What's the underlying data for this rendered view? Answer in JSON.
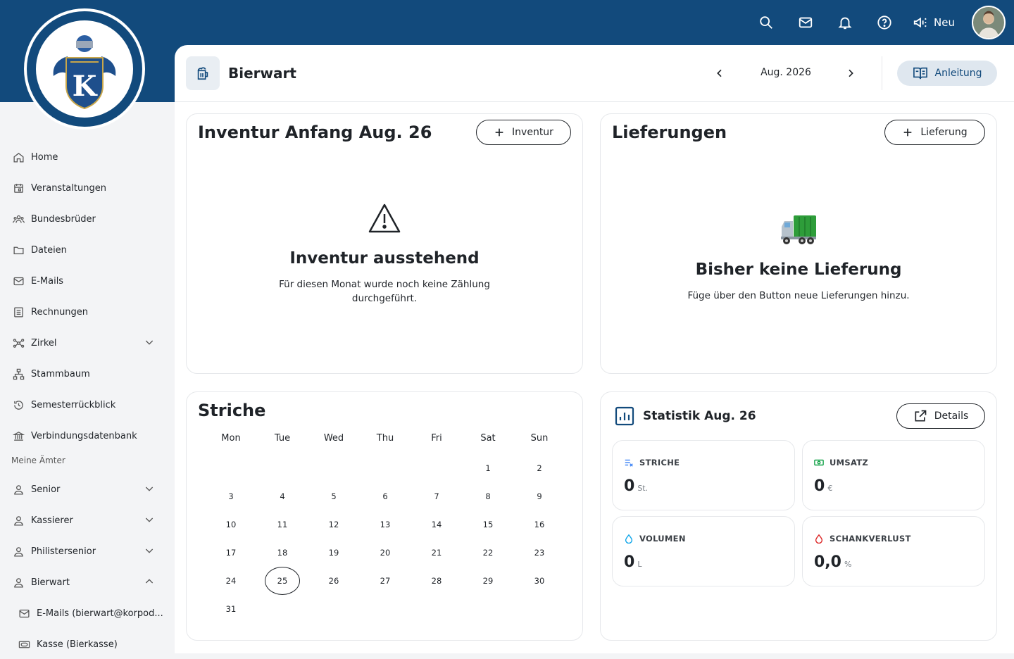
{
  "topbar": {
    "neu_label": "Neu"
  },
  "sidebar": {
    "items": [
      {
        "label": "Home"
      },
      {
        "label": "Veranstaltungen"
      },
      {
        "label": "Bundesbrüder"
      },
      {
        "label": "Dateien"
      },
      {
        "label": "E-Mails"
      },
      {
        "label": "Rechnungen"
      },
      {
        "label": "Zirkel"
      },
      {
        "label": "Stammbaum"
      },
      {
        "label": "Semesterrückblick"
      },
      {
        "label": "Verbindungsdatenbank"
      }
    ],
    "section_label": "Meine Ämter",
    "aemter": [
      {
        "label": "Senior"
      },
      {
        "label": "Kassierer"
      },
      {
        "label": "Philistersenior"
      },
      {
        "label": "Bierwart"
      }
    ],
    "sub_items": [
      {
        "label": "E-Mails (bierwart@korpod..."
      },
      {
        "label": "Kasse (Bierkasse)"
      }
    ]
  },
  "header": {
    "title": "Bierwart",
    "month": "Aug. 2026",
    "anleitung_label": "Anleitung"
  },
  "inventur": {
    "title": "Inventur Anfang Aug. 26",
    "button_label": "Inventur",
    "empty_title": "Inventur ausstehend",
    "empty_text_1": "Für diesen Monat wurde noch keine Zählung",
    "empty_text_2": "durchgeführt."
  },
  "lieferungen": {
    "title": "Lieferungen",
    "button_label": "Lieferung",
    "empty_title": "Bisher keine Lieferung",
    "empty_text": "Füge über den Button neue Lieferungen hinzu."
  },
  "striche": {
    "title": "Striche",
    "weekdays": [
      "Mon",
      "Tue",
      "Wed",
      "Thu",
      "Fri",
      "Sat",
      "Sun"
    ],
    "days": [
      "1",
      "2",
      "3",
      "4",
      "5",
      "6",
      "7",
      "8",
      "9",
      "10",
      "11",
      "12",
      "13",
      "14",
      "15",
      "16",
      "17",
      "18",
      "19",
      "20",
      "21",
      "22",
      "23",
      "24",
      "25",
      "26",
      "27",
      "28",
      "29",
      "30",
      "31"
    ],
    "first_weekday_index": 5,
    "today": "25"
  },
  "statistik": {
    "title": "Statistik Aug. 26",
    "details_label": "Details",
    "cards": [
      {
        "label": "STRICHE",
        "value": "0",
        "unit": "St.",
        "icon": "tally-icon",
        "color": "#3b82f6"
      },
      {
        "label": "UMSATZ",
        "value": "0",
        "unit": "€",
        "icon": "money-icon",
        "color": "#16a34a"
      },
      {
        "label": "VOLUMEN",
        "value": "0",
        "unit": "L",
        "icon": "droplet-icon",
        "color": "#0ea5e9"
      },
      {
        "label": "SCHANKVERLUST",
        "value": "0,0",
        "unit": "%",
        "icon": "droplet-icon",
        "color": "#dc2626"
      }
    ]
  }
}
